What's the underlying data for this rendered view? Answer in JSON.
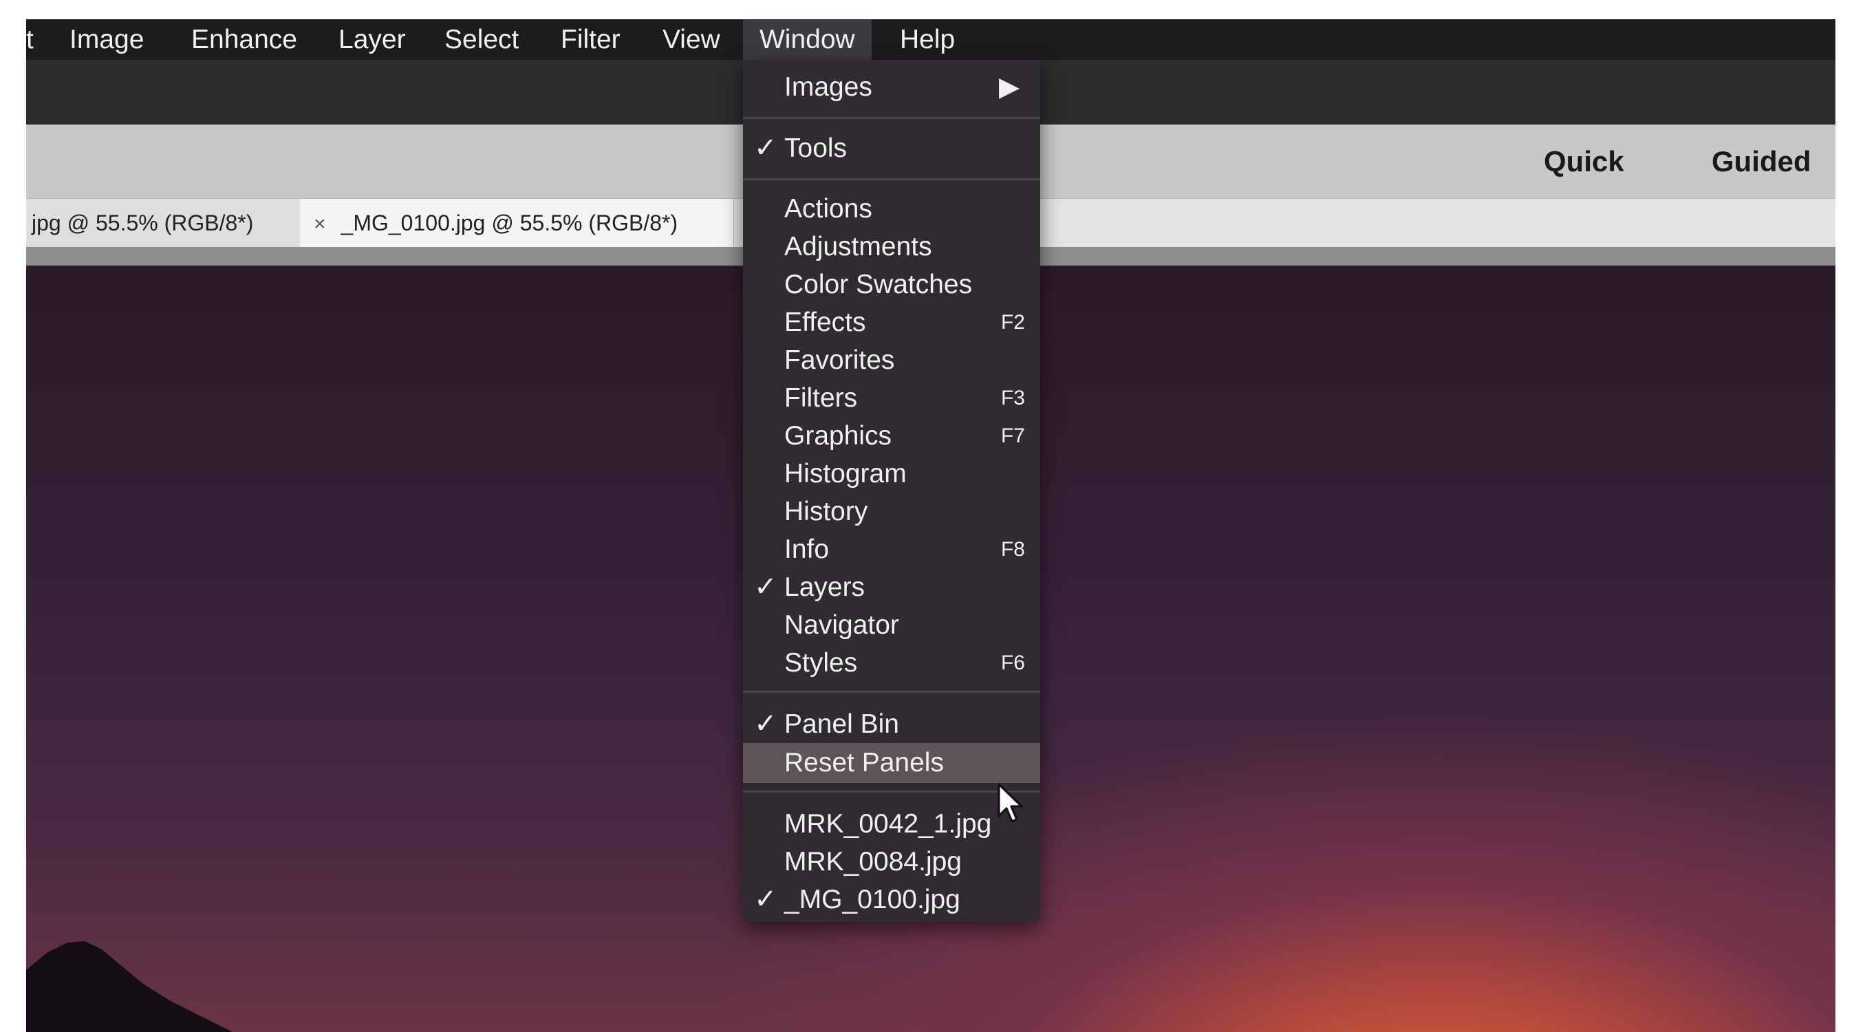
{
  "menubar": {
    "items": [
      "t",
      "Image",
      "Enhance",
      "Layer",
      "Select",
      "Filter",
      "View",
      "Window",
      "Help"
    ],
    "active": "Window"
  },
  "modes": {
    "quick": "Quick",
    "guided": "Guided"
  },
  "tabs": [
    {
      "label": "jpg @ 55.5% (RGB/8*)",
      "close": ""
    },
    {
      "label": "_MG_0100.jpg @ 55.5% (RGB/8*)",
      "close": "×"
    }
  ],
  "window_menu": {
    "images": {
      "label": "Images",
      "submenu_icon": "triangle-right-icon"
    },
    "tools": {
      "label": "Tools",
      "checked": true
    },
    "panels": [
      {
        "label": "Actions",
        "shortcut": ""
      },
      {
        "label": "Adjustments",
        "shortcut": ""
      },
      {
        "label": "Color Swatches",
        "shortcut": ""
      },
      {
        "label": "Effects",
        "shortcut": "F2"
      },
      {
        "label": "Favorites",
        "shortcut": ""
      },
      {
        "label": "Filters",
        "shortcut": "F3"
      },
      {
        "label": "Graphics",
        "shortcut": "F7"
      },
      {
        "label": "Histogram",
        "shortcut": ""
      },
      {
        "label": "History",
        "shortcut": ""
      },
      {
        "label": "Info",
        "shortcut": "F8"
      },
      {
        "label": "Layers",
        "shortcut": "",
        "checked": true
      },
      {
        "label": "Navigator",
        "shortcut": ""
      },
      {
        "label": "Styles",
        "shortcut": "F6"
      }
    ],
    "panel_bin": {
      "label": "Panel Bin",
      "checked": true
    },
    "reset_panels": {
      "label": "Reset Panels",
      "highlighted": true
    },
    "documents": [
      {
        "label": "MRK_0042_1.jpg",
        "checked": false
      },
      {
        "label": "MRK_0084.jpg",
        "checked": false
      },
      {
        "label": "_MG_0100.jpg",
        "checked": true
      }
    ],
    "check_glyph": "✓",
    "arrow_glyph": "▶"
  },
  "colors": {
    "menubar_bg": "#1d1b1e",
    "menu_bg": "#2f2b30",
    "menu_highlight": "#5c5458",
    "modebar_bg": "#c8c8c8"
  }
}
